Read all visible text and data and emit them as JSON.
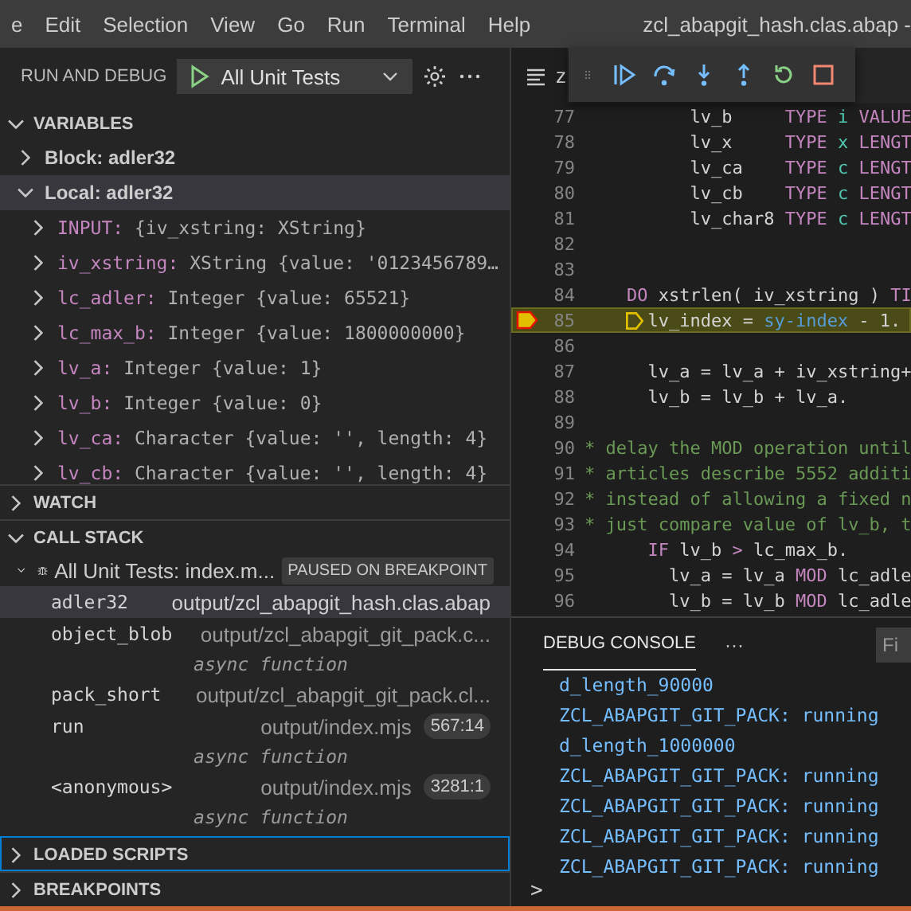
{
  "menu": [
    "e",
    "Edit",
    "Selection",
    "View",
    "Go",
    "Run",
    "Terminal",
    "Help"
  ],
  "title": "zcl_abapgit_hash.clas.abap -",
  "run_debug": {
    "label": "RUN AND DEBUG",
    "configuration": "All Unit Tests"
  },
  "variables": {
    "title": "VARIABLES",
    "expanded": true,
    "scopes": [
      {
        "label": "Block: adler32",
        "expanded": false,
        "selected": false
      },
      {
        "label": "Local: adler32",
        "expanded": true,
        "selected": true,
        "items": [
          {
            "name": "INPUT:",
            "value": "{iv_xstring: XString}"
          },
          {
            "name": "iv_xstring:",
            "value": "XString {value: '0123456789…"
          },
          {
            "name": "lc_adler:",
            "value": "Integer {value: 65521}"
          },
          {
            "name": "lc_max_b:",
            "value": "Integer {value: 1800000000}"
          },
          {
            "name": "lv_a:",
            "value": "Integer {value: 1}"
          },
          {
            "name": "lv_b:",
            "value": "Integer {value: 0}"
          },
          {
            "name": "lv_ca:",
            "value": "Character {value: '', length: 4}"
          },
          {
            "name": "lv_cb:",
            "value": "Character {value: '', length: 4}"
          }
        ]
      }
    ]
  },
  "watch": {
    "title": "WATCH",
    "expanded": false
  },
  "call_stack": {
    "title": "CALL STACK",
    "expanded": true,
    "thread": {
      "label": "All Unit Tests: index.m...",
      "expanded": true,
      "status": "PAUSED ON BREAKPOINT"
    },
    "frames": [
      {
        "kind": "frame",
        "name": "adler32",
        "source": "output/zcl_abapgit_hash.clas.abap",
        "selected": true
      },
      {
        "kind": "frame",
        "name": "object_blob",
        "source": "output/zcl_abapgit_git_pack.c...",
        "selected": false
      },
      {
        "kind": "async",
        "label": "async function"
      },
      {
        "kind": "frame",
        "name": "pack_short",
        "source": "output/zcl_abapgit_git_pack.cl...",
        "selected": false
      },
      {
        "kind": "frame",
        "name": "run",
        "source": "output/index.mjs",
        "position": "567:14",
        "selected": false
      },
      {
        "kind": "async",
        "label": "async function"
      },
      {
        "kind": "frame",
        "name": "<anonymous>",
        "source": "output/index.mjs",
        "position": "3281:1",
        "selected": false
      },
      {
        "kind": "async",
        "label": "async function"
      }
    ]
  },
  "loaded_scripts": {
    "title": "LOADED SCRIPTS",
    "expanded": false,
    "focused": true
  },
  "breakpoints": {
    "title": "BREAKPOINTS",
    "expanded": false
  },
  "editor": {
    "tab": "z",
    "lines": [
      {
        "number": "77",
        "current": false,
        "tokens": [
          {
            "kind": "id",
            "text": "          lv_b     "
          },
          {
            "kind": "kw",
            "text": "TYPE"
          },
          {
            "kind": "type",
            "text": " i"
          },
          {
            "kind": "kw",
            "text": " VALUE"
          }
        ]
      },
      {
        "number": "78",
        "current": false,
        "tokens": [
          {
            "kind": "id",
            "text": "          lv_x     "
          },
          {
            "kind": "kw",
            "text": "TYPE"
          },
          {
            "kind": "type",
            "text": " x"
          },
          {
            "kind": "kw",
            "text": " LENGT"
          }
        ]
      },
      {
        "number": "79",
        "current": false,
        "tokens": [
          {
            "kind": "id",
            "text": "          lv_ca    "
          },
          {
            "kind": "kw",
            "text": "TYPE"
          },
          {
            "kind": "type",
            "text": " c"
          },
          {
            "kind": "kw",
            "text": " LENGT"
          }
        ]
      },
      {
        "number": "80",
        "current": false,
        "tokens": [
          {
            "kind": "id",
            "text": "          lv_cb    "
          },
          {
            "kind": "kw",
            "text": "TYPE"
          },
          {
            "kind": "type",
            "text": " c"
          },
          {
            "kind": "kw",
            "text": " LENGT"
          }
        ]
      },
      {
        "number": "81",
        "current": false,
        "tokens": [
          {
            "kind": "id",
            "text": "          lv_char8 "
          },
          {
            "kind": "kw",
            "text": "TYPE"
          },
          {
            "kind": "type",
            "text": " c"
          },
          {
            "kind": "kw",
            "text": " LENGT"
          }
        ]
      },
      {
        "number": "82",
        "current": false
      },
      {
        "number": "83",
        "current": false
      },
      {
        "number": "84",
        "current": false,
        "tokens": [
          {
            "kind": "kw",
            "text": "    DO"
          },
          {
            "kind": "id",
            "text": " xstrlen( iv_xstring ) "
          },
          {
            "kind": "kw",
            "text": "TI"
          }
        ]
      },
      {
        "number": "85",
        "current": true,
        "tokens": [
          {
            "kind": "id",
            "text": "lv_index = "
          },
          {
            "kind": "sys",
            "text": "sy-index"
          },
          {
            "kind": "id",
            "text": " - 1."
          }
        ]
      },
      {
        "number": "86",
        "current": false
      },
      {
        "number": "87",
        "current": false,
        "tokens": [
          {
            "kind": "id",
            "text": "      lv_a = lv_a + iv_xstring+"
          }
        ]
      },
      {
        "number": "88",
        "current": false,
        "tokens": [
          {
            "kind": "id",
            "text": "      lv_b = lv_b + lv_a."
          }
        ]
      },
      {
        "number": "89",
        "current": false
      },
      {
        "number": "90",
        "current": false,
        "tokens": [
          {
            "kind": "comment",
            "text": "* delay the MOD operation until"
          }
        ]
      },
      {
        "number": "91",
        "current": false,
        "tokens": [
          {
            "kind": "comment",
            "text": "* articles describe 5552 additi"
          }
        ]
      },
      {
        "number": "92",
        "current": false,
        "tokens": [
          {
            "kind": "comment",
            "text": "* instead of allowing a fixed n"
          }
        ]
      },
      {
        "number": "93",
        "current": false,
        "tokens": [
          {
            "kind": "comment",
            "text": "* just compare value of lv_b, t"
          }
        ]
      },
      {
        "number": "94",
        "current": false,
        "tokens": [
          {
            "kind": "kw",
            "text": "      IF"
          },
          {
            "kind": "id",
            "text": " lv_b "
          },
          {
            "kind": "kw",
            "text": ">"
          },
          {
            "kind": "id",
            "text": " lc_max_b."
          }
        ]
      },
      {
        "number": "95",
        "current": false,
        "tokens": [
          {
            "kind": "id",
            "text": "        lv_a = lv_a "
          },
          {
            "kind": "kw",
            "text": "MOD"
          },
          {
            "kind": "id",
            "text": " lc_adle"
          }
        ]
      },
      {
        "number": "96",
        "current": false,
        "tokens": [
          {
            "kind": "id",
            "text": "        lv_b = lv_b "
          },
          {
            "kind": "kw",
            "text": "MOD"
          },
          {
            "kind": "id",
            "text": " lc_adle"
          }
        ]
      }
    ]
  },
  "panel": {
    "tabs": [
      {
        "label": "DEBUG CONSOLE",
        "selected": true
      }
    ],
    "more": "···",
    "filter_placeholder": "Fi",
    "output": [
      "d_length_90000",
      "ZCL_ABAPGIT_GIT_PACK: running",
      "d_length_1000000",
      "ZCL_ABAPGIT_GIT_PACK: running",
      "ZCL_ABAPGIT_GIT_PACK: running",
      "ZCL_ABAPGIT_GIT_PACK: running",
      "ZCL_ABAPGIT_GIT_PACK: running"
    ],
    "prompt": ">"
  }
}
